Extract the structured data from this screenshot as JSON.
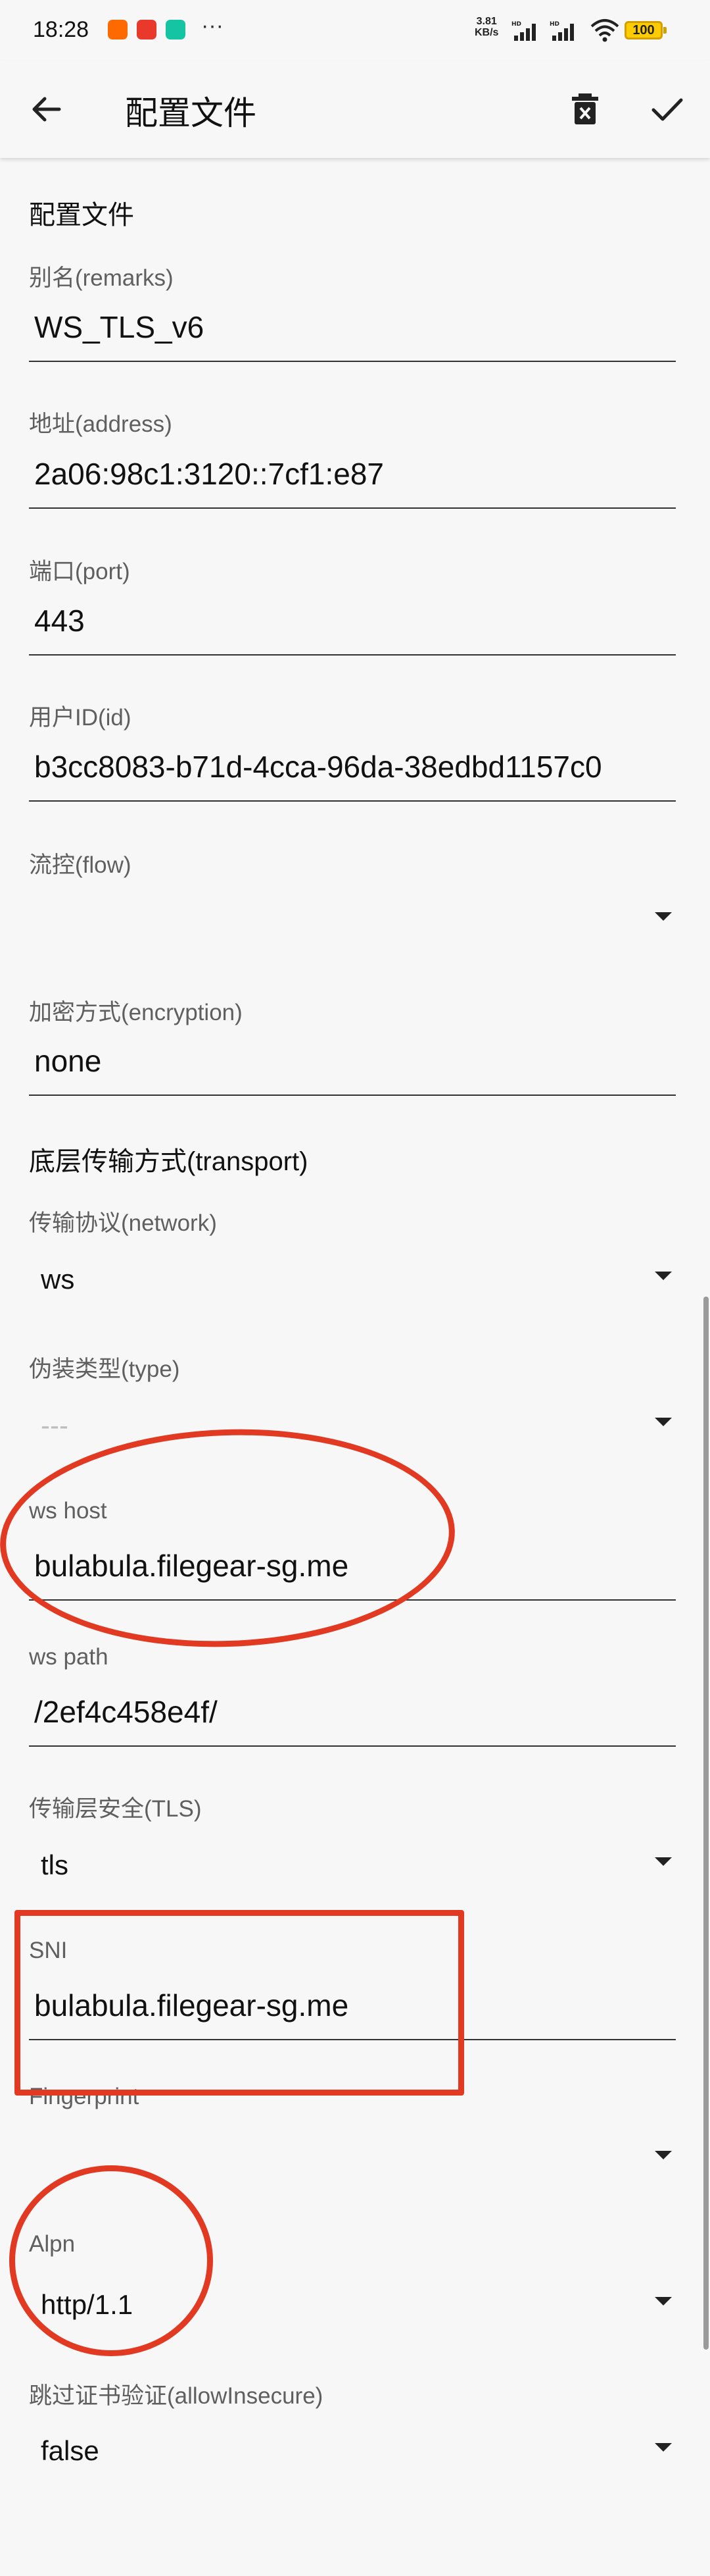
{
  "status_bar": {
    "time": "18:28",
    "speed_value": "3.81",
    "speed_unit": "KB/s",
    "battery": "100",
    "more": "···",
    "signal_tag": "HD"
  },
  "app_bar": {
    "title": "配置文件"
  },
  "form": {
    "section_profile": "配置文件",
    "remarks_label": "别名(remarks)",
    "remarks_value": "WS_TLS_v6",
    "address_label": "地址(address)",
    "address_value": "2a06:98c1:3120::7cf1:e87",
    "port_label": "端口(port)",
    "port_value": "443",
    "id_label": "用户ID(id)",
    "id_value": "b3cc8083-b71d-4cca-96da-38edbd1157c0",
    "flow_label": "流控(flow)",
    "flow_value": "",
    "encryption_label": "加密方式(encryption)",
    "encryption_value": "none",
    "section_transport": "底层传输方式(transport)",
    "network_label": "传输协议(network)",
    "network_value": "ws",
    "type_label": "伪装类型(type)",
    "type_value": "---",
    "ws_host_label": "ws host",
    "ws_host_value": "bulabula.filegear-sg.me",
    "ws_path_label": "ws path",
    "ws_path_value": "/2ef4c458e4f/",
    "tls_label": "传输层安全(TLS)",
    "tls_value": "tls",
    "sni_label": "SNI",
    "sni_value": "bulabula.filegear-sg.me",
    "fingerprint_label": "Fingerprint",
    "fingerprint_value": "",
    "alpn_label": "Alpn",
    "alpn_value": "http/1.1",
    "insecure_label": "跳过证书验证(allowInsecure)",
    "insecure_value": "false"
  },
  "colors": {
    "background": "#f7f7f7",
    "annotation_red": "#e23a22",
    "underline": "#333333"
  }
}
